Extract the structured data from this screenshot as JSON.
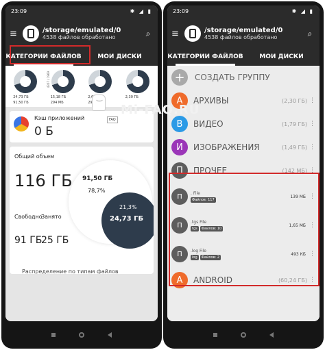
{
  "status_bar": {
    "time": "23:09"
  },
  "appbar": {
    "path": "/storage/emulated/0",
    "subtitle": "4538 файлов обработано"
  },
  "tabs": {
    "categories": "КАТЕГОРИИ ФАЙЛОВ",
    "disks": "МОИ ДИСКИ"
  },
  "left": {
    "donuts": [
      {
        "line1": "24,73 ГБ",
        "line2": "91,50 ГБ",
        "side": ""
      },
      {
        "line1": "15,18 ГБ",
        "line2": "294 МБ",
        "side": "4307 / 1969"
      },
      {
        "line1": "2,64 ГБ",
        "line2": "294 МБ",
        "side": ""
      },
      {
        "line1": "2,30 ГБ",
        "line2": "",
        "side": ""
      }
    ],
    "cache": {
      "label": "Кэш приложений",
      "value": "0 Б"
    },
    "overall": {
      "label": "Общий объем",
      "total": "116 ГБ",
      "free_label": "Свободно",
      "free_value": "91 ГБ",
      "used_label": "Занято",
      "used_value": "25 ГБ",
      "pie_free_value": "91,50 ГБ",
      "pie_free_pct": "78,7%",
      "pie_used_pct": "21,3%",
      "pie_used_value": "24,73 ГБ"
    },
    "distribution": "Распределение по типам файлов"
  },
  "right": {
    "create_group": "СОЗДАТЬ ГРУППУ",
    "categories": [
      {
        "letter": "А",
        "name": "АРХИВЫ",
        "size": "(2,30 ГБ)",
        "color": "#ef6b2b"
      },
      {
        "letter": "В",
        "name": "ВИДЕО",
        "size": "(1,79 ГБ)",
        "color": "#2b9ae6"
      },
      {
        "letter": "И",
        "name": "ИЗОБРАЖЕНИЯ",
        "size": "(1,49 ГБ)",
        "color": "#9b36b8"
      },
      {
        "letter": "П",
        "name": "ПРОЧЕЕ",
        "size": "(142 МБ)",
        "color": "#5d5d5d"
      }
    ],
    "files": [
      {
        "name": ". File",
        "tags": [
          "Файлов: 117"
        ],
        "size": "139 МБ"
      },
      {
        "name": ".tgs File",
        "tags": [
          "tgs",
          "Файлов: 10"
        ],
        "size": "1,65 МБ"
      },
      {
        "name": ".log File",
        "tags": [
          "log",
          "Файлов: 2"
        ],
        "size": "493 КБ"
      }
    ],
    "android": {
      "letter": "А",
      "name": "ANDROID",
      "size": "(60,24 ГБ)",
      "color": "#ef6b2b"
    }
  },
  "watermark": {
    "text": "Mi-FAQ.RU",
    "tag": "FAQ"
  }
}
